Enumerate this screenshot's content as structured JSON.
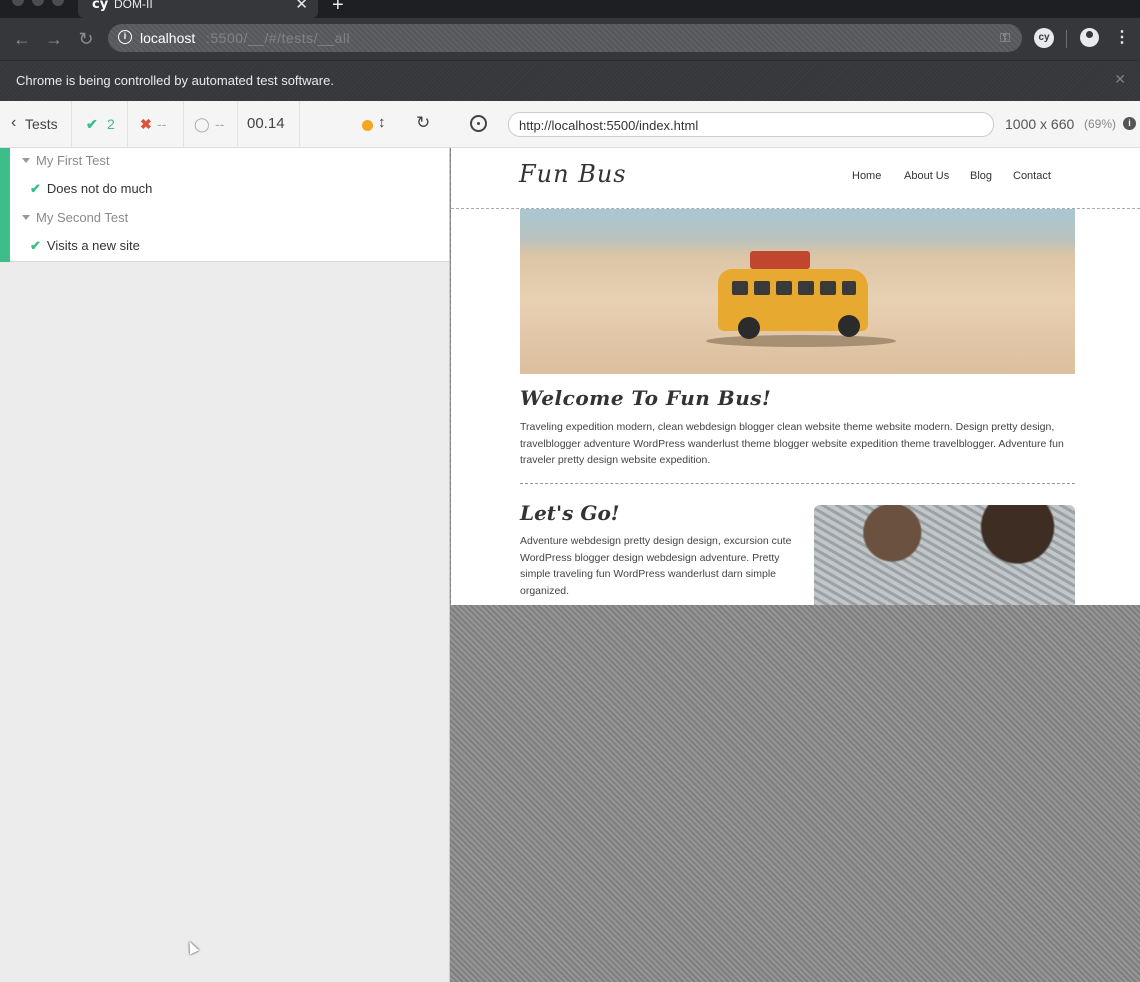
{
  "browser": {
    "tab_title": "DOM-II",
    "favicon": "cy",
    "address_host": "localhost",
    "address_rest": ":5500/__/#/tests/__all",
    "infobar_message": "Chrome is being controlled by automated test software.",
    "extension_label": "cy"
  },
  "reporter": {
    "tests_label": "Tests",
    "passed_count": "2",
    "failed_count": "--",
    "pending_count": "--",
    "duration": "00.14",
    "suites": [
      {
        "title": "My First Test",
        "tests": [
          {
            "title": "Does not do much",
            "state": "passed"
          }
        ]
      },
      {
        "title": "My Second Test",
        "tests": [
          {
            "title": "Visits a new site",
            "state": "passed"
          }
        ]
      }
    ]
  },
  "runner": {
    "url": "http://localhost:5500/index.html",
    "viewport": "1000 x 660",
    "scale": "(69%)"
  },
  "site": {
    "logo": "Fun Bus",
    "nav": [
      "Home",
      "About Us",
      "Blog",
      "Contact"
    ],
    "intro_heading": "Welcome To Fun Bus!",
    "intro_text": "Traveling expedition modern, clean webdesign blogger clean website theme website modern. Design pretty design, travelblogger adventure WordPress wanderlust theme blogger website expedition theme travelblogger. Adventure fun traveler pretty design website expedition.",
    "section_heading": "Let's Go!",
    "section_text": "Adventure webdesign pretty design design, excursion cute WordPress blogger design webdesign adventure. Pretty simple traveling fun WordPress wanderlust darn simple organized."
  },
  "colors": {
    "passed": "#3cbd8a",
    "failed": "#e0513b",
    "running_dot": "#f5a623"
  }
}
